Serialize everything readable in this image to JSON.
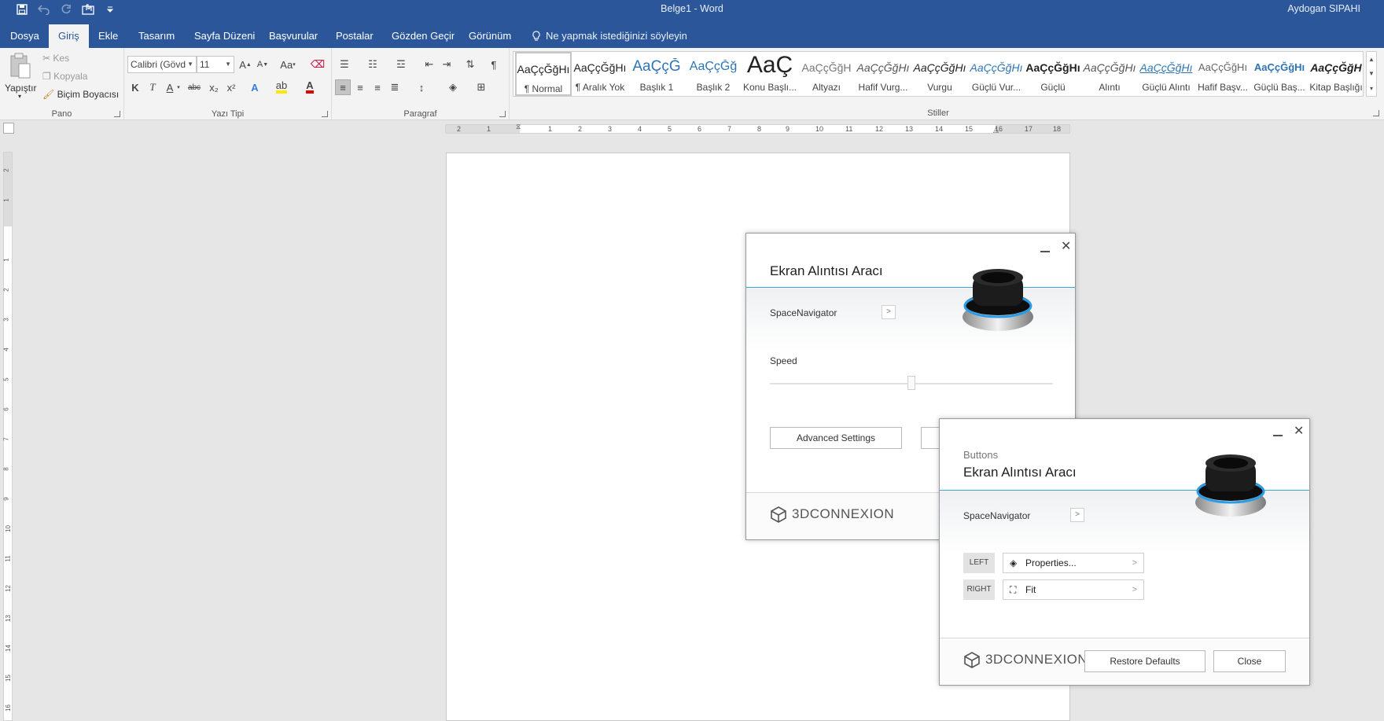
{
  "window": {
    "title": "Belge1  -  Word",
    "user": "Aydogan SIPAHI"
  },
  "colors": {
    "brand_blue": "#2b579a",
    "accent_line": "#3ea7de"
  },
  "quick_access": [
    "save-icon",
    "undo-icon",
    "redo-icon",
    "touch-mode-icon",
    "customize-icon"
  ],
  "tabs": [
    {
      "label": "Dosya"
    },
    {
      "label": "Giriş",
      "active": true
    },
    {
      "label": "Ekle"
    },
    {
      "label": "Tasarım"
    },
    {
      "label": "Sayfa Düzeni"
    },
    {
      "label": "Başvurular"
    },
    {
      "label": "Postalar"
    },
    {
      "label": "Gözden Geçir"
    },
    {
      "label": "Görünüm"
    }
  ],
  "tell_me": "Ne yapmak istediğinizi söyleyin",
  "clipboard": {
    "paste": "Yapıştır",
    "cut": "Kes",
    "copy": "Kopyala",
    "format_painter": "Biçim Boyacısı",
    "group": "Pano"
  },
  "font": {
    "name": "Calibri (Gövd",
    "size": "11",
    "case": "Aa",
    "bold": "K",
    "italic": "T",
    "underline": "A",
    "strike": "abc",
    "subscript": "x₂",
    "superscript": "x²",
    "group": "Yazı Tipi"
  },
  "paragraph": {
    "group": "Paragraf",
    "pilcrow": "¶"
  },
  "styles": {
    "group": "Stiller",
    "items": [
      {
        "preview": "AaÇçĞğHı",
        "name": "¶ Normal",
        "selected": true
      },
      {
        "preview": "AaÇçĞğHı",
        "name": "¶ Aralık Yok"
      },
      {
        "preview": "AaÇçĞ",
        "name": "Başlık 1",
        "color": "#2e74b5",
        "size": 19
      },
      {
        "preview": "AaÇçĞğ",
        "name": "Başlık 2",
        "color": "#2e74b5",
        "size": 16
      },
      {
        "preview": "AaÇ",
        "name": "Konu Başlı...",
        "size": 30
      },
      {
        "preview": "AaÇçĞğH",
        "name": "Altyazı",
        "color": "#777"
      },
      {
        "preview": "AaÇçĞğHı",
        "name": "Hafif Vurg...",
        "italic": true
      },
      {
        "preview": "AaÇçĞğHı",
        "name": "Vurgu",
        "italic": true
      },
      {
        "preview": "AaÇçĞğHı",
        "name": "Güçlü Vur...",
        "italic": true,
        "color": "#2e74b5"
      },
      {
        "preview": "AaÇçĞğHı",
        "name": "Güçlü",
        "bold": true
      },
      {
        "preview": "AaÇçĞğHı",
        "name": "Alıntı",
        "italic": true
      },
      {
        "preview": "AaÇçĞğHı",
        "name": "Güçlü Alıntı",
        "italic": true,
        "color": "#2e74b5"
      },
      {
        "preview": "AaÇçĞğHı",
        "name": "Hafif Başv..."
      },
      {
        "preview": "AaÇçĞğHı",
        "name": "Güçlü Baş...",
        "color": "#2e74b5",
        "bold": true
      },
      {
        "preview": "AaÇçĞğH",
        "name": "Kitap Başlığı",
        "bold": true,
        "italic": true
      }
    ]
  },
  "ruler": {
    "horizontal": [
      "2",
      "1",
      "1",
      "2",
      "3",
      "4",
      "5",
      "6",
      "7",
      "8",
      "9",
      "10",
      "11",
      "12",
      "13",
      "14",
      "15",
      "16",
      "17",
      "18"
    ],
    "vertical": [
      "2",
      "1",
      "1",
      "2",
      "3",
      "4",
      "5",
      "6",
      "7",
      "8",
      "9",
      "10",
      "11",
      "12",
      "13",
      "14",
      "15",
      "16"
    ]
  },
  "dialog_main": {
    "title": "Ekran Alıntısı Aracı",
    "device": "SpaceNavigator",
    "speed_label": "Speed",
    "speed_value": 0.5,
    "advanced_button": "Advanced Settings",
    "brand": "3DCONNEXION"
  },
  "dialog_buttons": {
    "subtitle": "Buttons",
    "title": "Ekran Alıntısı Aracı",
    "device": "SpaceNavigator",
    "left_tag": "LEFT",
    "left_action": "Properties...",
    "right_tag": "RIGHT",
    "right_action": "Fit",
    "restore_button": "Restore Defaults",
    "close_button": "Close",
    "brand": "3DCONNEXION"
  }
}
